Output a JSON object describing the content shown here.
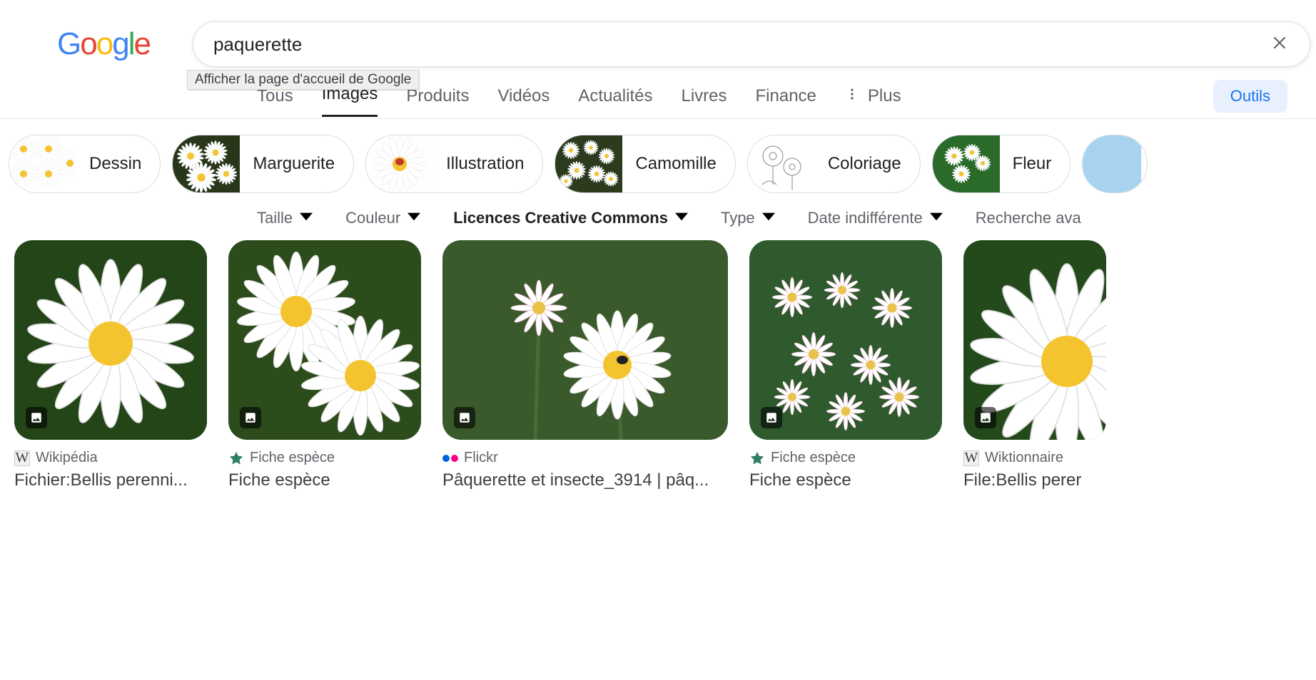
{
  "logo_tooltip": "Afficher la page d'accueil de Google",
  "search": {
    "query": "paquerette"
  },
  "nav": {
    "all": "Tous",
    "images": "Images",
    "produits": "Produits",
    "videos": "Vidéos",
    "actualites": "Actualités",
    "livres": "Livres",
    "finance": "Finance",
    "plus": "Plus",
    "outils": "Outils"
  },
  "chips": {
    "dessin": "Dessin",
    "marguerite": "Marguerite",
    "illustration": "Illustration",
    "camomille": "Camomille",
    "coloriage": "Coloriage",
    "fleur": "Fleur"
  },
  "filters": {
    "taille": "Taille",
    "couleur": "Couleur",
    "licences": "Licences Creative Commons",
    "type": "Type",
    "date": "Date indifférente",
    "recherche_avancee": "Recherche ava"
  },
  "results": [
    {
      "source": "Wikipédia",
      "title": "Fichier:Bellis perenni...",
      "favicon": "w"
    },
    {
      "source": "Fiche espèce",
      "title": "Fiche espèce",
      "favicon": "star"
    },
    {
      "source": "Flickr",
      "title": "Pâquerette et insecte_3914 | pâq...",
      "favicon": "flickr"
    },
    {
      "source": "Fiche espèce",
      "title": "Fiche espèce",
      "favicon": "star"
    },
    {
      "source": "Wiktionnaire",
      "title": "File:Bellis perer",
      "favicon": "w"
    }
  ]
}
